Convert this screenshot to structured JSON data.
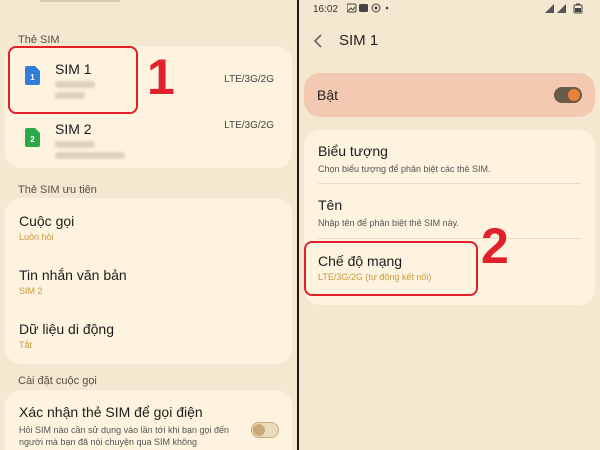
{
  "left": {
    "section_sim_cards": "Thẻ SIM",
    "sim1": {
      "name": "SIM 1",
      "network": "LTE/3G/2G",
      "badge": "1",
      "color": "#2f7ed8"
    },
    "sim2": {
      "name": "SIM 2",
      "network": "LTE/3G/2G",
      "badge": "2",
      "color": "#2aa84a"
    },
    "annotation_1": "1",
    "section_preferred": "Thẻ SIM ưu tiên",
    "calls": {
      "label": "Cuộc gọi",
      "value": "Luôn hỏi"
    },
    "messages": {
      "label": "Tin nhắn văn bản",
      "value": "SIM 2"
    },
    "mobile_data": {
      "label": "Dữ liệu di động",
      "value": "Tắt"
    },
    "section_call_settings": "Cài đặt cuộc gọi",
    "confirm_sim": {
      "label": "Xác nhận thẻ SIM để gọi điện",
      "desc": "Hỏi SIM nào cần sử dụng vào lần tới khi bạn gọi đến người mà bạn đã nói chuyện qua SIM không",
      "enabled": false
    }
  },
  "right": {
    "status_time": "16:02",
    "header_title": "SIM 1",
    "on_label": "Bật",
    "on_enabled": true,
    "icon_setting": {
      "label": "Biểu tượng",
      "desc": "Chọn biểu tượng để phân biệt các thẻ SIM."
    },
    "name_setting": {
      "label": "Tên",
      "desc": "Nhập tên để phân biệt thẻ SIM này."
    },
    "network_mode": {
      "label": "Chế độ mạng",
      "value": "LTE/3G/2G (tự động kết nối)"
    },
    "annotation_2": "2"
  },
  "colors": {
    "accent": "#e8823a",
    "annotation": "#e0202a",
    "highlight_card": "#f3c9b2",
    "subtext": "#c99a3e"
  }
}
